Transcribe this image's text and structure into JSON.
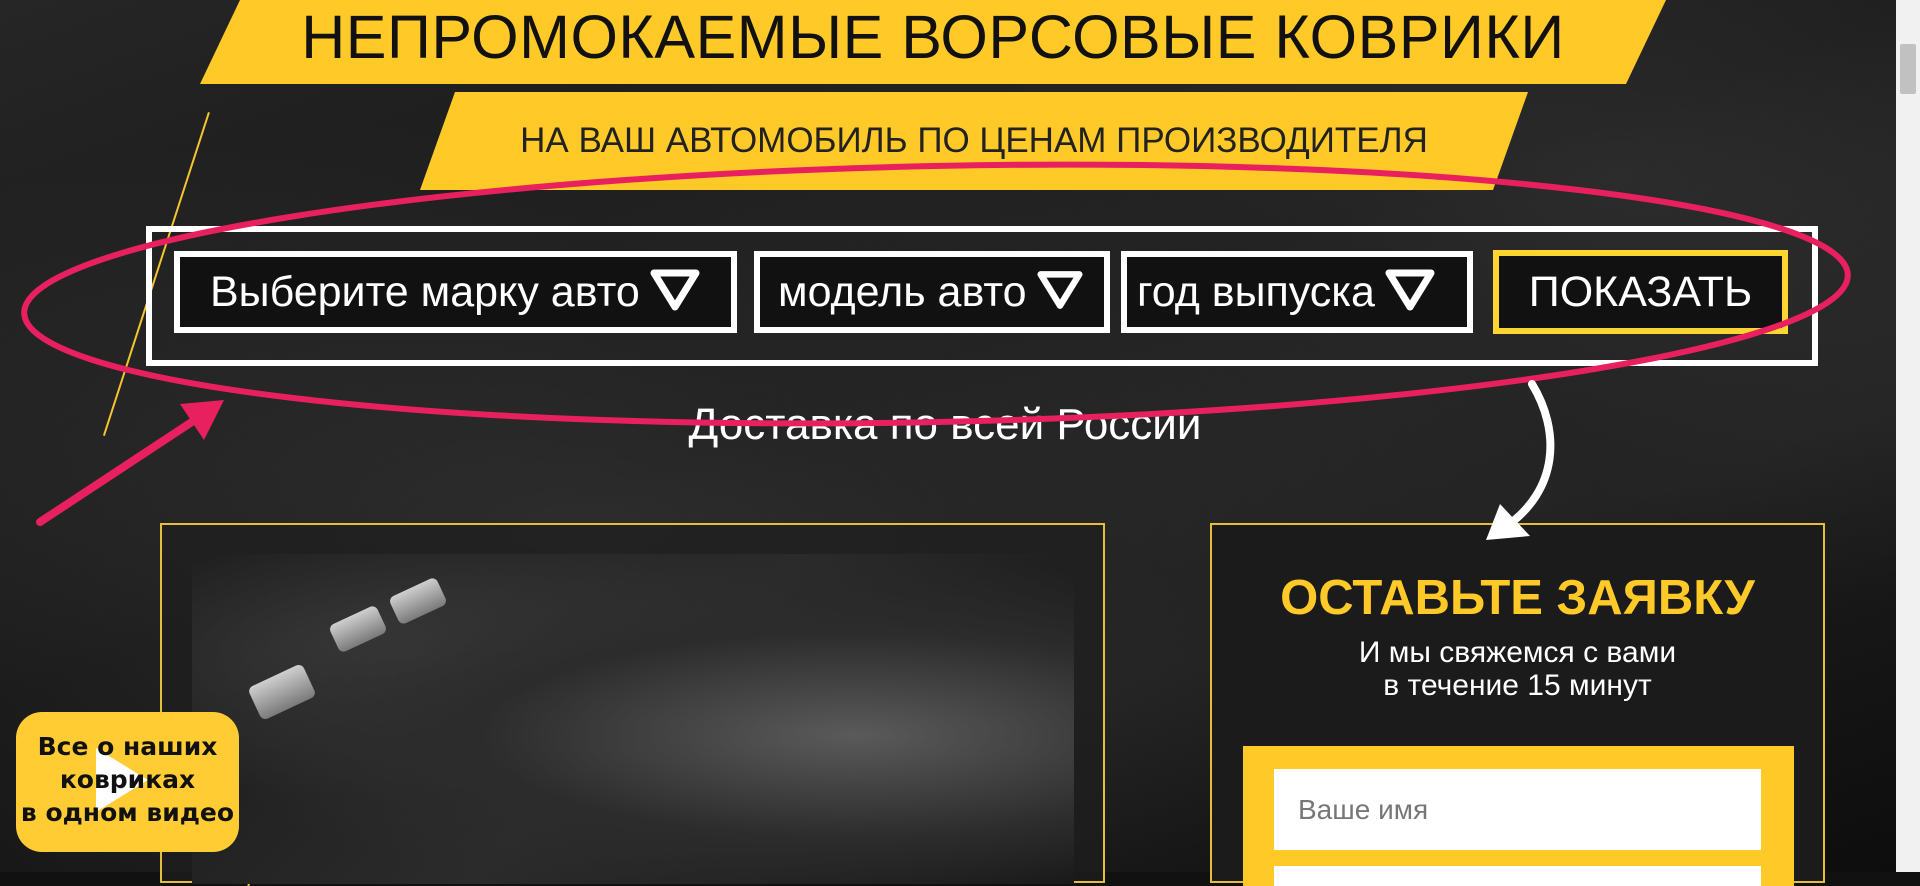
{
  "page": {
    "title": "НЕПРОМОКАЕМЫЕ ВОРСОВЫЕ КОВРИКИ",
    "subtitle": "НА ВАШ АВТОМОБИЛЬ ПО ЦЕНАМ ПРОИЗВОДИТЕЛЯ",
    "delivery": "Доставка по всей России"
  },
  "filters": {
    "brand_select": "Выберите марку авто",
    "model_select": "модель авто",
    "year_select": "год выпуска",
    "show_button": "ПОКАЗАТЬ"
  },
  "video_badge": {
    "lines": [
      "Все о наших",
      "ковриках",
      "в одном видео"
    ]
  },
  "form": {
    "title": "ОСТАВЬТЕ ЗАЯВКУ",
    "subtitle_lines": [
      "И мы свяжемся с вами",
      "в течение 15 минут"
    ],
    "name_placeholder": "Ваше имя"
  },
  "colors": {
    "accent_yellow": "#ffc928",
    "annotation_pink": "#e8205f",
    "background_dark": "#111111"
  },
  "icons": {
    "dropdown": "triangle-down-icon",
    "video": "play-icon"
  }
}
